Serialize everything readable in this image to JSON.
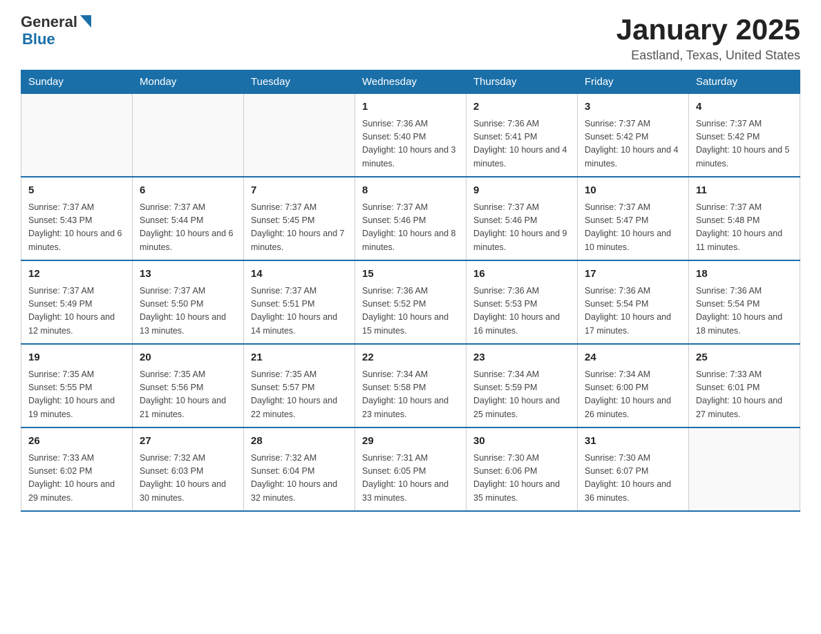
{
  "logo": {
    "general": "General",
    "blue": "Blue"
  },
  "title": "January 2025",
  "subtitle": "Eastland, Texas, United States",
  "days_of_week": [
    "Sunday",
    "Monday",
    "Tuesday",
    "Wednesday",
    "Thursday",
    "Friday",
    "Saturday"
  ],
  "weeks": [
    [
      {
        "day": "",
        "info": ""
      },
      {
        "day": "",
        "info": ""
      },
      {
        "day": "",
        "info": ""
      },
      {
        "day": "1",
        "info": "Sunrise: 7:36 AM\nSunset: 5:40 PM\nDaylight: 10 hours and 3 minutes."
      },
      {
        "day": "2",
        "info": "Sunrise: 7:36 AM\nSunset: 5:41 PM\nDaylight: 10 hours and 4 minutes."
      },
      {
        "day": "3",
        "info": "Sunrise: 7:37 AM\nSunset: 5:42 PM\nDaylight: 10 hours and 4 minutes."
      },
      {
        "day": "4",
        "info": "Sunrise: 7:37 AM\nSunset: 5:42 PM\nDaylight: 10 hours and 5 minutes."
      }
    ],
    [
      {
        "day": "5",
        "info": "Sunrise: 7:37 AM\nSunset: 5:43 PM\nDaylight: 10 hours and 6 minutes."
      },
      {
        "day": "6",
        "info": "Sunrise: 7:37 AM\nSunset: 5:44 PM\nDaylight: 10 hours and 6 minutes."
      },
      {
        "day": "7",
        "info": "Sunrise: 7:37 AM\nSunset: 5:45 PM\nDaylight: 10 hours and 7 minutes."
      },
      {
        "day": "8",
        "info": "Sunrise: 7:37 AM\nSunset: 5:46 PM\nDaylight: 10 hours and 8 minutes."
      },
      {
        "day": "9",
        "info": "Sunrise: 7:37 AM\nSunset: 5:46 PM\nDaylight: 10 hours and 9 minutes."
      },
      {
        "day": "10",
        "info": "Sunrise: 7:37 AM\nSunset: 5:47 PM\nDaylight: 10 hours and 10 minutes."
      },
      {
        "day": "11",
        "info": "Sunrise: 7:37 AM\nSunset: 5:48 PM\nDaylight: 10 hours and 11 minutes."
      }
    ],
    [
      {
        "day": "12",
        "info": "Sunrise: 7:37 AM\nSunset: 5:49 PM\nDaylight: 10 hours and 12 minutes."
      },
      {
        "day": "13",
        "info": "Sunrise: 7:37 AM\nSunset: 5:50 PM\nDaylight: 10 hours and 13 minutes."
      },
      {
        "day": "14",
        "info": "Sunrise: 7:37 AM\nSunset: 5:51 PM\nDaylight: 10 hours and 14 minutes."
      },
      {
        "day": "15",
        "info": "Sunrise: 7:36 AM\nSunset: 5:52 PM\nDaylight: 10 hours and 15 minutes."
      },
      {
        "day": "16",
        "info": "Sunrise: 7:36 AM\nSunset: 5:53 PM\nDaylight: 10 hours and 16 minutes."
      },
      {
        "day": "17",
        "info": "Sunrise: 7:36 AM\nSunset: 5:54 PM\nDaylight: 10 hours and 17 minutes."
      },
      {
        "day": "18",
        "info": "Sunrise: 7:36 AM\nSunset: 5:54 PM\nDaylight: 10 hours and 18 minutes."
      }
    ],
    [
      {
        "day": "19",
        "info": "Sunrise: 7:35 AM\nSunset: 5:55 PM\nDaylight: 10 hours and 19 minutes."
      },
      {
        "day": "20",
        "info": "Sunrise: 7:35 AM\nSunset: 5:56 PM\nDaylight: 10 hours and 21 minutes."
      },
      {
        "day": "21",
        "info": "Sunrise: 7:35 AM\nSunset: 5:57 PM\nDaylight: 10 hours and 22 minutes."
      },
      {
        "day": "22",
        "info": "Sunrise: 7:34 AM\nSunset: 5:58 PM\nDaylight: 10 hours and 23 minutes."
      },
      {
        "day": "23",
        "info": "Sunrise: 7:34 AM\nSunset: 5:59 PM\nDaylight: 10 hours and 25 minutes."
      },
      {
        "day": "24",
        "info": "Sunrise: 7:34 AM\nSunset: 6:00 PM\nDaylight: 10 hours and 26 minutes."
      },
      {
        "day": "25",
        "info": "Sunrise: 7:33 AM\nSunset: 6:01 PM\nDaylight: 10 hours and 27 minutes."
      }
    ],
    [
      {
        "day": "26",
        "info": "Sunrise: 7:33 AM\nSunset: 6:02 PM\nDaylight: 10 hours and 29 minutes."
      },
      {
        "day": "27",
        "info": "Sunrise: 7:32 AM\nSunset: 6:03 PM\nDaylight: 10 hours and 30 minutes."
      },
      {
        "day": "28",
        "info": "Sunrise: 7:32 AM\nSunset: 6:04 PM\nDaylight: 10 hours and 32 minutes."
      },
      {
        "day": "29",
        "info": "Sunrise: 7:31 AM\nSunset: 6:05 PM\nDaylight: 10 hours and 33 minutes."
      },
      {
        "day": "30",
        "info": "Sunrise: 7:30 AM\nSunset: 6:06 PM\nDaylight: 10 hours and 35 minutes."
      },
      {
        "day": "31",
        "info": "Sunrise: 7:30 AM\nSunset: 6:07 PM\nDaylight: 10 hours and 36 minutes."
      },
      {
        "day": "",
        "info": ""
      }
    ]
  ]
}
